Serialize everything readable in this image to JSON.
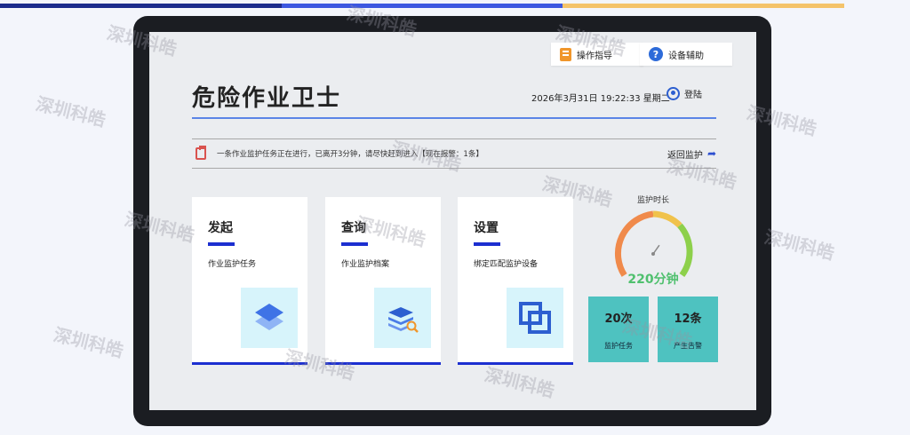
{
  "colors": {
    "accent_blue": "#1c2fd0",
    "header_line": "#5b84e6",
    "gauge_green": "#4fc06e",
    "stat_teal": "#4ec2c0",
    "top_gradient": [
      "#1c2b8c",
      "#3c57e0",
      "#f4c36a"
    ]
  },
  "header": {
    "guide_button": {
      "label": "操作指导",
      "icon": "book-icon"
    },
    "assist_button": {
      "label": "设备辅助",
      "icon": "help-icon"
    },
    "title": "危险作业卫士",
    "datetime": "2026年3月31日 19:22:33 星期二",
    "login": {
      "label": "登陆",
      "icon": "user-icon"
    }
  },
  "notice": {
    "icon": "clipboard-icon",
    "text": "一条作业监护任务正在进行，已离开3分钟，请尽快赶到进入【现在报警：1条】",
    "return_label": "返回监护",
    "return_icon": "return-arrow-icon"
  },
  "cards": [
    {
      "title": "发起",
      "subtitle": "作业监护任务",
      "icon": "layers-icon"
    },
    {
      "title": "查询",
      "subtitle": "作业监护档案",
      "icon": "database-search-icon"
    },
    {
      "title": "设置",
      "subtitle": "绑定匹配监护设备",
      "icon": "link-squares-icon"
    }
  ],
  "gauge": {
    "title": "监护时长",
    "value_text": "220分钟",
    "level": 0.63
  },
  "stats": [
    {
      "value": "20次",
      "label": "监护任务"
    },
    {
      "value": "12条",
      "label": "产生告警"
    }
  ],
  "watermark": "深圳科皓"
}
